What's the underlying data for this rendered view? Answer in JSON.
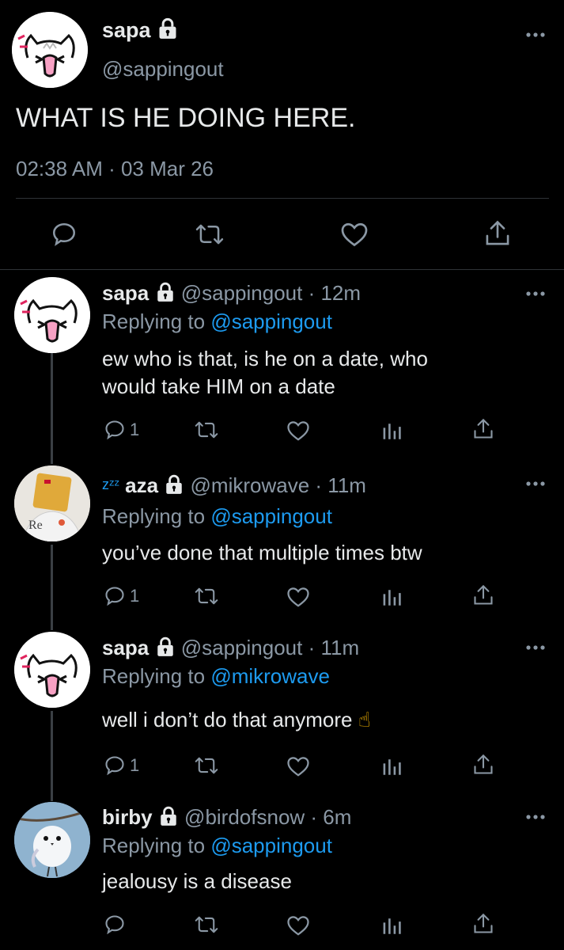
{
  "colors": {
    "background": "#000000",
    "text": "#e7e9ea",
    "muted": "#8b98a5",
    "link": "#1d9bf0",
    "divider": "#2f3336"
  },
  "main_tweet": {
    "name": "sapa",
    "handle": "@sappingout",
    "text": "WHAT IS HE DOING HERE.",
    "timestamp": "02:38 AM · 03 Mar 26",
    "actions": [
      "reply-icon",
      "retweet-icon",
      "like-icon",
      "share-icon"
    ]
  },
  "replies": [
    {
      "name": "sapa",
      "handle": "@sappingout",
      "time": "· 12m",
      "replying_label": "Replying to",
      "replying_to": "@sappingout",
      "text_lines": [
        "ew who is that, is he on a date, who",
        "would take HIM on a date"
      ],
      "reply_count": "1"
    },
    {
      "name_prefix": "zᶻᶻ",
      "name": "aza",
      "handle": "@mikrowave",
      "time": "· 11m",
      "replying_label": "Replying to",
      "replying_to": "@sappingout",
      "text_lines": [
        "you’ve done that multiple times btw"
      ],
      "reply_count": "1"
    },
    {
      "name": "sapa",
      "handle": "@sappingout",
      "time": "· 11m",
      "replying_label": "Replying to",
      "replying_to": "@mikrowave",
      "text_lines": [
        "well i don’t do that anymore"
      ],
      "emoji": "☝",
      "reply_count": "1"
    },
    {
      "name": "birby",
      "handle": "@birdofsnow",
      "time": "· 6m",
      "replying_label": "Replying to",
      "replying_to": "@sappingout",
      "text_lines": [
        "jealousy is a disease"
      ],
      "reply_count": ""
    }
  ]
}
